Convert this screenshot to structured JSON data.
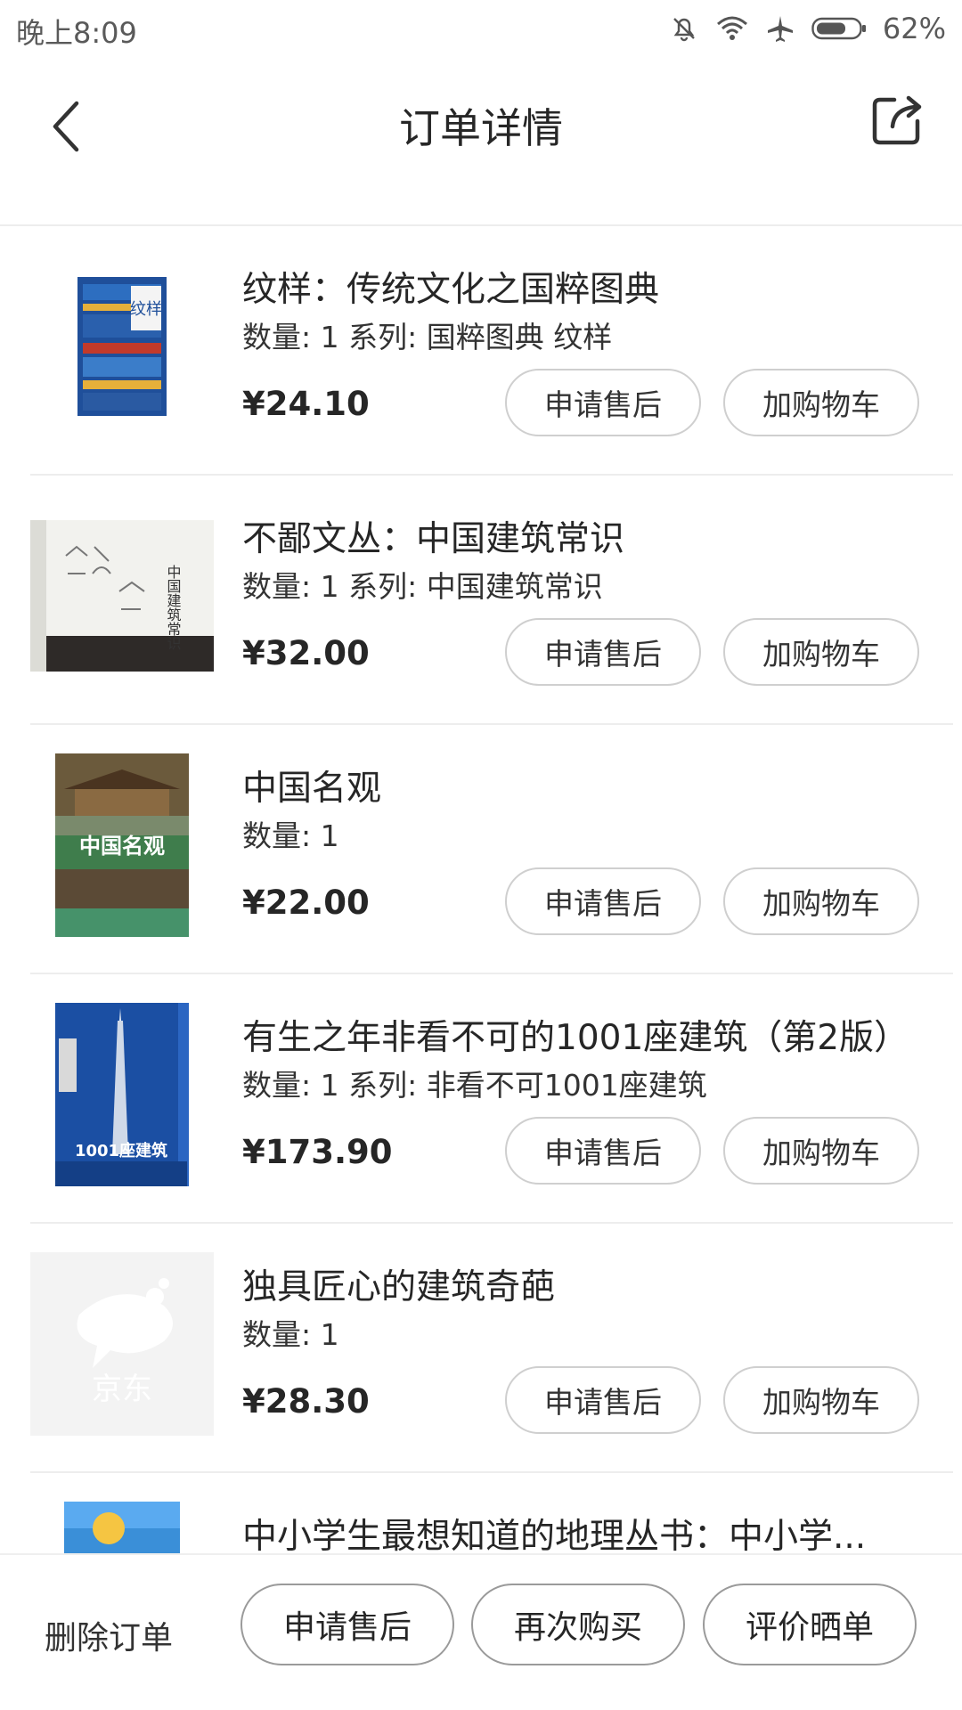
{
  "status_bar": {
    "time": "晚上8:09",
    "battery_percent": "62%",
    "icons": [
      "bell-off-icon",
      "wifi-icon",
      "airplane-icon",
      "battery-icon"
    ]
  },
  "header": {
    "title": "订单详情",
    "back_icon": "chevron-left-icon",
    "share_icon": "share-icon"
  },
  "items": [
    {
      "name": "纹样：传统文化之国粹图典",
      "meta": "数量: 1 系列: 国粹图典 纹样",
      "price": "¥24.10",
      "after_sale_label": "申请售后",
      "add_cart_label": "加购物车",
      "cover_text": "纹样",
      "cover_color": "#1f4f9a"
    },
    {
      "name": "不鄙文丛：中国建筑常识",
      "meta": "数量: 1 系列: 中国建筑常识",
      "price": "¥32.00",
      "after_sale_label": "申请售后",
      "add_cart_label": "加购物车",
      "cover_text": "中国建筑常识",
      "cover_color": "#f2f2ee"
    },
    {
      "name": "中国名观",
      "meta": "数量: 1",
      "price": "¥22.00",
      "after_sale_label": "申请售后",
      "add_cart_label": "加购物车",
      "cover_text": "中国名观",
      "cover_color": "#3f7d4c"
    },
    {
      "name": "有生之年非看不可的1001座建筑（第2版）",
      "meta": "数量: 1 系列: 非看不可1001座建筑",
      "price": "¥173.90",
      "after_sale_label": "申请售后",
      "add_cart_label": "加购物车",
      "cover_text": "1001座建筑",
      "cover_color": "#1b4fa3"
    },
    {
      "name": "独具匠心的建筑奇葩",
      "meta": "数量: 1",
      "price": "¥28.30",
      "after_sale_label": "申请售后",
      "add_cart_label": "加购物车",
      "cover_text": "京东",
      "cover_color": "#f3f3f3"
    },
    {
      "name": "中小学生最想知道的地理丛书：中小学...",
      "cover_text": "",
      "cover_color": "#3a8fd8"
    }
  ],
  "bottom_bar": {
    "delete_label": "删除订单",
    "after_sale_label": "申请售后",
    "rebuy_label": "再次购买",
    "review_label": "评价晒单"
  }
}
